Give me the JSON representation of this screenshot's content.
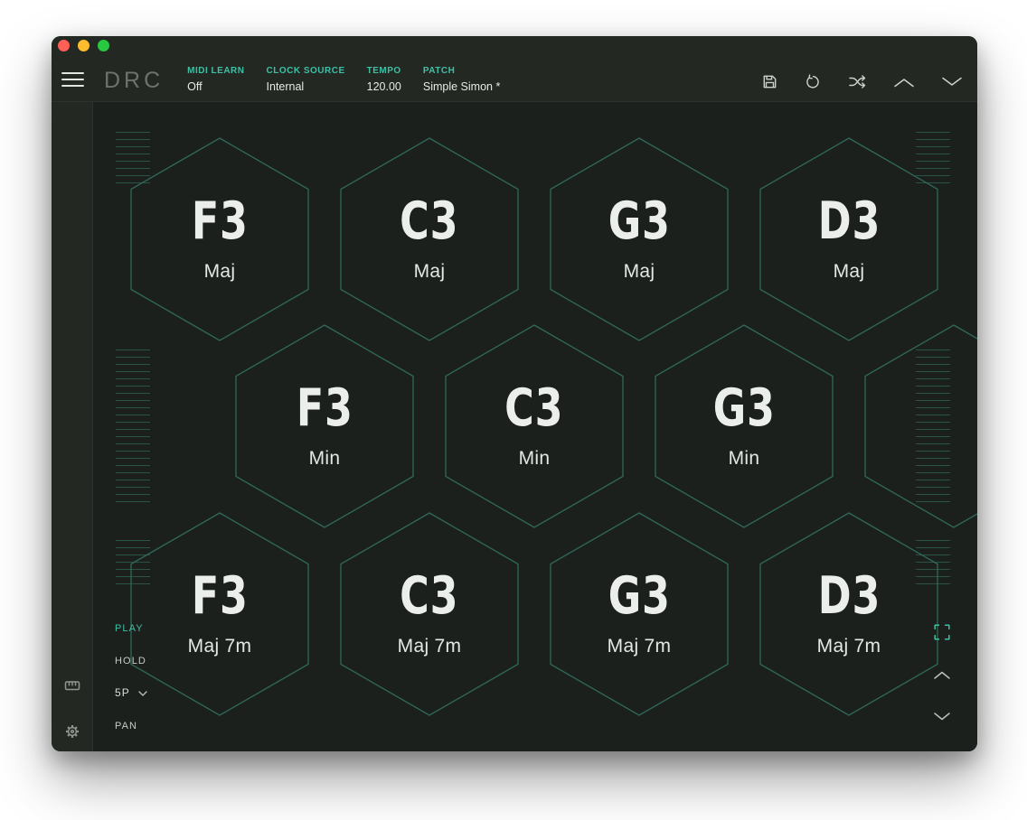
{
  "colors": {
    "accent": "#3fbfa4",
    "hexline": "#30695a",
    "ruleline": "#2a5348",
    "chrome": "#232823",
    "mainbg": "#1c201c",
    "traffic_red": "#ff5f57",
    "traffic_yellow": "#febc2e",
    "traffic_green": "#28c840"
  },
  "header": {
    "logo": "DRC",
    "params": [
      {
        "label": "MIDI LEARN",
        "value": "Off"
      },
      {
        "label": "CLOCK SOURCE",
        "value": "Internal"
      },
      {
        "label": "TEMPO",
        "value": "120.00"
      },
      {
        "label": "PATCH",
        "value": "Simple Simon *"
      }
    ]
  },
  "pads": {
    "rows": [
      {
        "cells": [
          {
            "note": "F3",
            "quality": "Maj"
          },
          {
            "note": "C3",
            "quality": "Maj"
          },
          {
            "note": "G3",
            "quality": "Maj"
          },
          {
            "note": "D3",
            "quality": "Maj"
          }
        ]
      },
      {
        "cells": [
          {
            "note": "F3",
            "quality": "Min"
          },
          {
            "note": "C3",
            "quality": "Min"
          },
          {
            "note": "G3",
            "quality": "Min"
          }
        ]
      },
      {
        "cells": [
          {
            "note": "F3",
            "quality": "Maj 7m"
          },
          {
            "note": "C3",
            "quality": "Maj 7m"
          },
          {
            "note": "G3",
            "quality": "Maj 7m"
          },
          {
            "note": "D3",
            "quality": "Maj 7m"
          }
        ]
      }
    ]
  },
  "controls": {
    "play": "PLAY",
    "hold": "HOLD",
    "voicing": "5P",
    "pan": "PAN"
  }
}
